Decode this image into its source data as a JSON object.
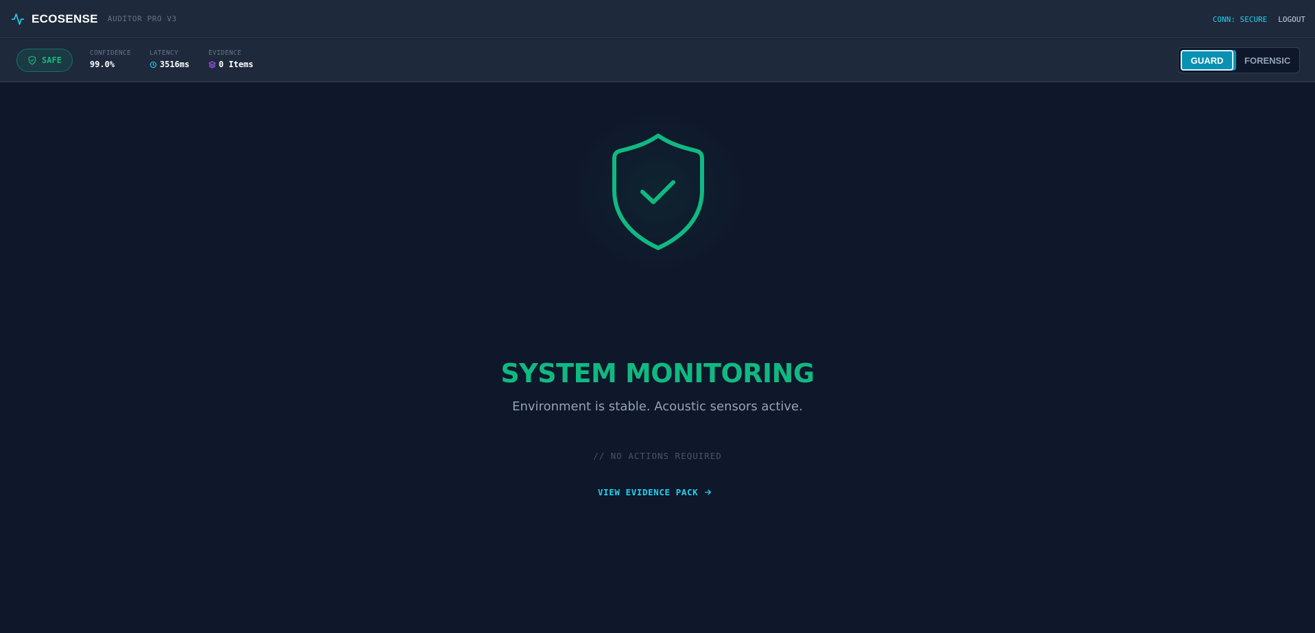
{
  "header": {
    "brand_name": "ECOSENSE",
    "brand_sub": "AUDITOR PRO V3",
    "brand_icon": "activity-icon",
    "connection": "CONN: SECURE",
    "logout_label": "LOGOUT"
  },
  "status": {
    "badge": "SAFE",
    "badge_icon": "shield-check-icon",
    "metrics": [
      {
        "label": "CONFIDENCE",
        "value": "99.0%"
      },
      {
        "label": "LATENCY",
        "value": "3516ms",
        "icon": "clock-icon"
      },
      {
        "label": "EVIDENCE",
        "value": "0 Items",
        "icon": "layers-icon"
      }
    ],
    "modes": [
      {
        "label": "GUARD",
        "active": true
      },
      {
        "label": "FORENSIC",
        "active": false
      }
    ]
  },
  "main": {
    "icon": "shield-check-icon",
    "title": "SYSTEM MONITORING",
    "subtitle": "Environment is stable. Acoustic sensors active.",
    "note": "// NO ACTIONS REQUIRED",
    "link_label": "VIEW EVIDENCE PACK",
    "link_icon": "arrow-right-icon"
  },
  "colors": {
    "accent": "#10b981",
    "cyan": "#22d3ee",
    "background": "#0f172a",
    "panel": "#1e293b"
  }
}
